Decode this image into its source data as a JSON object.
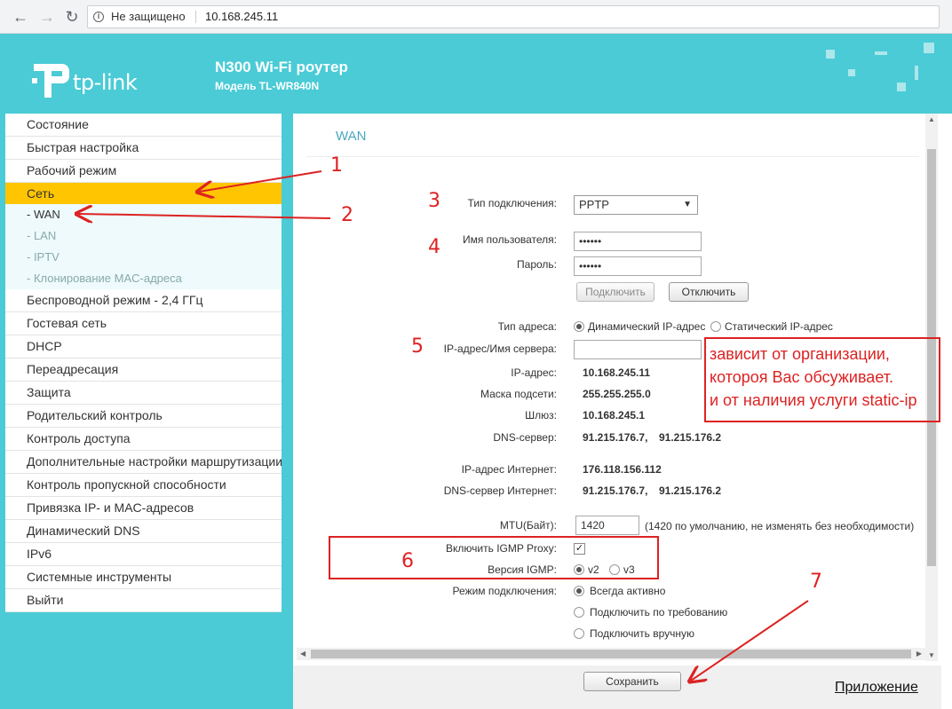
{
  "browser": {
    "security_label": "Не защищено",
    "url": "10.168.245.11"
  },
  "header": {
    "logo_text": "tp-link",
    "product_name": "N300 Wi-Fi роутер",
    "model": "Модель TL-WR840N"
  },
  "sidebar": {
    "items": [
      {
        "label": "Состояние"
      },
      {
        "label": "Быстрая настройка"
      },
      {
        "label": "Рабочий режим"
      },
      {
        "label": "Сеть"
      },
      {
        "label": "Беспроводной режим - 2,4 ГГц"
      },
      {
        "label": "Гостевая сеть"
      },
      {
        "label": "DHCP"
      },
      {
        "label": "Переадресация"
      },
      {
        "label": "Защита"
      },
      {
        "label": "Родительский контроль"
      },
      {
        "label": "Контроль доступа"
      },
      {
        "label": "Дополнительные настройки маршрутизации"
      },
      {
        "label": "Контроль пропускной способности"
      },
      {
        "label": "Привязка IP- и MAC-адресов"
      },
      {
        "label": "Динамический DNS"
      },
      {
        "label": "IPv6"
      },
      {
        "label": "Системные инструменты"
      },
      {
        "label": "Выйти"
      }
    ],
    "subitems": [
      {
        "label": "- WAN"
      },
      {
        "label": "- LAN"
      },
      {
        "label": "- IPTV"
      },
      {
        "label": "- Клонирование MAC-адреса"
      }
    ]
  },
  "wan": {
    "title": "WAN",
    "connection_type_label": "Тип подключения:",
    "connection_type_value": "PPTP",
    "username_label": "Имя пользователя:",
    "username_value": "••••••",
    "password_label": "Пароль:",
    "password_value": "••••••",
    "connect_button": "Подключить",
    "disconnect_button": "Отключить",
    "address_type_label": "Тип адреса:",
    "address_dynamic": "Динамический IP-адрес",
    "address_static": "Статический IP-адрес",
    "server_label": "IP-адрес/Имя сервера:",
    "server_value": "",
    "ip_label": "IP-адрес:",
    "ip_value": "10.168.245.11",
    "mask_label": "Маска подсети:",
    "mask_value": "255.255.255.0",
    "gateway_label": "Шлюз:",
    "gateway_value": "10.168.245.1",
    "dns_label": "DNS-сервер:",
    "dns_value1": "91.215.176.7,",
    "dns_value2": "91.215.176.2",
    "inet_ip_label": "IP-адрес Интернет:",
    "inet_ip_value": "176.118.156.112",
    "inet_dns_label": "DNS-сервер Интернет:",
    "inet_dns_value1": "91.215.176.7,",
    "inet_dns_value2": "91.215.176.2",
    "mtu_label": "MTU(Байт):",
    "mtu_value": "1420",
    "mtu_note": "(1420 по умолчанию, не изменять без необходимости)",
    "igmp_proxy_label": "Включить IGMP Proxy:",
    "igmp_version_label": "Версия IGMP:",
    "igmp_v2": "v2",
    "igmp_v3": "v3",
    "conn_mode_label": "Режим подключения:",
    "mode_always": "Всегда активно",
    "mode_demand": "Подключить по требованию",
    "mode_manual": "Подключить вручную"
  },
  "footer": {
    "save_button": "Сохранить",
    "app_link": "Приложение"
  },
  "annotations": {
    "n1": "1",
    "n2": "2",
    "n3": "3",
    "n4": "4",
    "n5": "5",
    "n6": "6",
    "n7": "7",
    "note_line1": "зависит от организации,",
    "note_line2": "котороя Вас обсуживает.",
    "note_line3": "и от наличия услуги static-ip",
    "color": "#d22222"
  },
  "colors": {
    "brand_teal": "#4acbd6",
    "active_menu": "#ffc500"
  }
}
